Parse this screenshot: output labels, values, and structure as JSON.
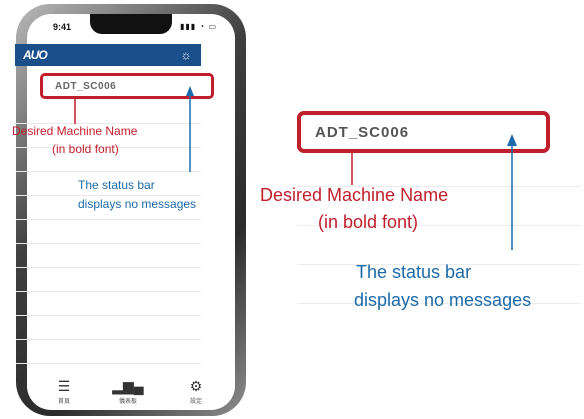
{
  "phone": {
    "status_time": "9:41",
    "logo": "AUO",
    "machine_name": "ADT_SC006",
    "tabs": [
      {
        "icon": "home-grid-icon",
        "label": "首頁"
      },
      {
        "icon": "bar-chart-icon",
        "label": "儀表板"
      },
      {
        "icon": "gear-icon",
        "label": "設定"
      }
    ]
  },
  "annotations": {
    "left_red_line1": "Desired Machine Name",
    "left_red_line2": "(in bold font)",
    "left_blue_line1": "The status bar",
    "left_blue_line2": "displays no messages",
    "right_machine_name": "ADT_SC006",
    "right_red_line1": "Desired Machine Name",
    "right_red_line2": "(in bold font)",
    "right_blue_line1": "The status bar",
    "right_blue_line2": "displays no messages"
  },
  "colors": {
    "red": "#c11e2c",
    "blue": "#1c6aa8",
    "header": "#1a4f8a"
  }
}
